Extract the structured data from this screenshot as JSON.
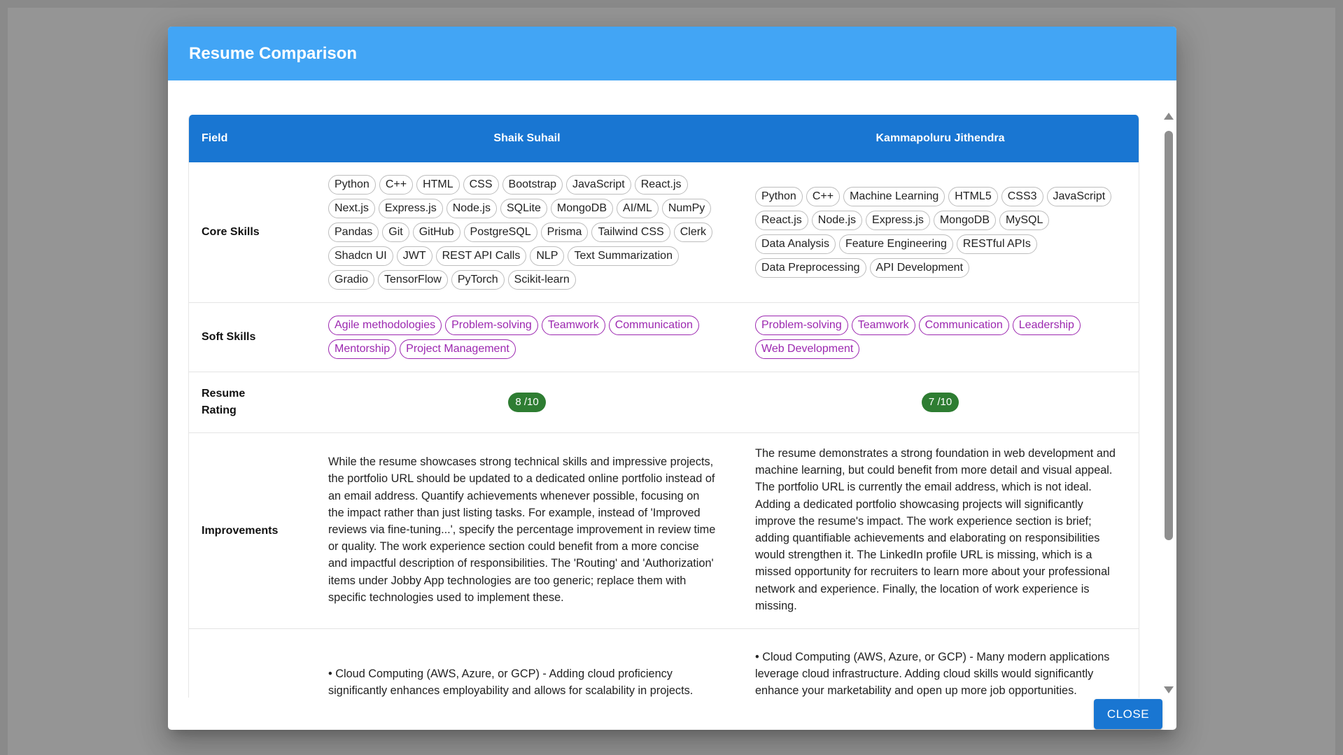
{
  "dialog": {
    "title": "Resume Comparison",
    "close_label": "CLOSE"
  },
  "table": {
    "headers": {
      "field": "Field",
      "candidate_a": "Shaik Suhail",
      "candidate_b": "Kammapoluru Jithendra"
    },
    "rows": {
      "core_skills": {
        "label": "Core Skills",
        "a": [
          "Python",
          "C++",
          "HTML",
          "CSS",
          "Bootstrap",
          "JavaScript",
          "React.js",
          "Next.js",
          "Express.js",
          "Node.js",
          "SQLite",
          "MongoDB",
          "AI/ML",
          "NumPy",
          "Pandas",
          "Git",
          "GitHub",
          "PostgreSQL",
          "Prisma",
          "Tailwind CSS",
          "Clerk",
          "Shadcn UI",
          "JWT",
          "REST API Calls",
          "NLP",
          "Text Summarization",
          "Gradio",
          "TensorFlow",
          "PyTorch",
          "Scikit-learn"
        ],
        "b": [
          "Python",
          "C++",
          "Machine Learning",
          "HTML5",
          "CSS3",
          "JavaScript",
          "React.js",
          "Node.js",
          "Express.js",
          "MongoDB",
          "MySQL",
          "Data Analysis",
          "Feature Engineering",
          "RESTful APIs",
          "Data Preprocessing",
          "API Development"
        ]
      },
      "soft_skills": {
        "label": "Soft Skills",
        "a": [
          "Agile methodologies",
          "Problem-solving",
          "Teamwork",
          "Communication",
          "Mentorship",
          "Project Management"
        ],
        "b": [
          "Problem-solving",
          "Teamwork",
          "Communication",
          "Leadership",
          "Web Development"
        ]
      },
      "rating": {
        "label": "Resume Rating",
        "a": "8 /10",
        "b": "7 /10"
      },
      "improvements": {
        "label": "Improvements",
        "a": "While the resume showcases strong technical skills and impressive projects, the portfolio URL should be updated to a dedicated online portfolio instead of an email address. Quantify achievements whenever possible, focusing on the impact rather than just listing tasks. For example, instead of 'Improved reviews via fine-tuning...', specify the percentage improvement in review time or quality. The work experience section could benefit from a more concise and impactful description of responsibilities. The 'Routing' and 'Authorization' items under Jobby App technologies are too generic; replace them with specific technologies used to implement these.",
        "b": "The resume demonstrates a strong foundation in web development and machine learning, but could benefit from more detail and visual appeal. The portfolio URL is currently the email address, which is not ideal. Adding a dedicated portfolio showcasing projects will significantly improve the resume's impact. The work experience section is brief; adding quantifiable achievements and elaborating on responsibilities would strengthen it. The LinkedIn profile URL is missing, which is a missed opportunity for recruiters to learn more about your professional network and experience. Finally, the location of work experience is missing."
      },
      "suggested_skills": {
        "label": "",
        "a": "• Cloud Computing (AWS, Azure, or GCP) - Adding cloud proficiency significantly enhances employability and allows for scalability in projects.",
        "b": "• Cloud Computing (AWS, Azure, or GCP) - Many modern applications leverage cloud infrastructure. Adding cloud skills would significantly enhance your marketability and open up more job opportunities."
      }
    }
  },
  "colors": {
    "header_bar": "#42a5f5",
    "table_header": "#1976d2",
    "rating_badge": "#2e7d32",
    "soft_chip": "#9c27b0",
    "backdrop": "#8a8a8a"
  }
}
